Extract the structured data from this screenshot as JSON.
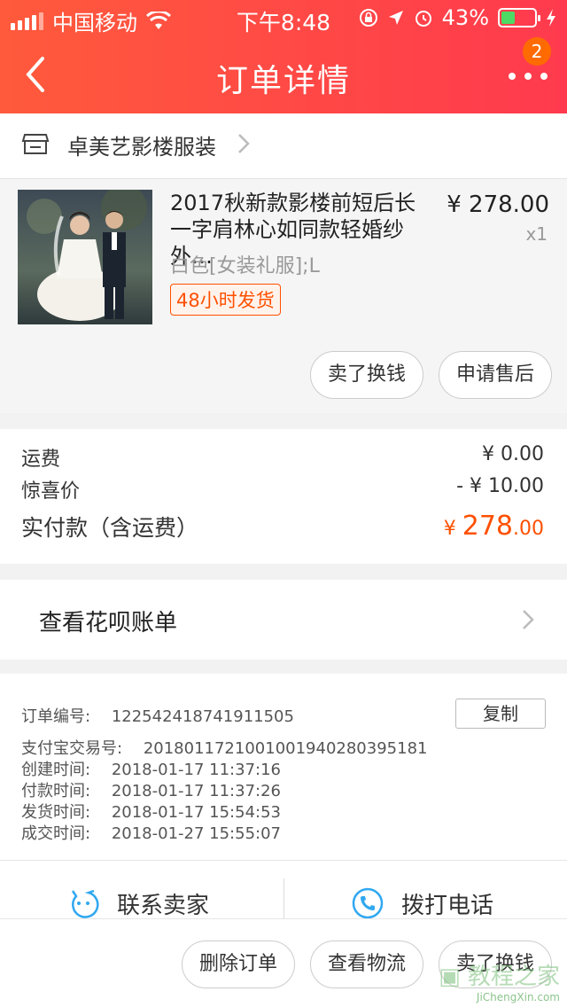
{
  "status_bar": {
    "carrier": "中国移动",
    "time": "下午8:48",
    "battery_percent": "43%",
    "battery_level": 0.43,
    "icons": [
      "signal-icon",
      "wifi-icon",
      "orientation-lock-icon",
      "location-arrow-icon",
      "alarm-icon",
      "battery-icon",
      "charging-icon"
    ]
  },
  "header": {
    "title": "订单详情",
    "notification_count": "2"
  },
  "shop": {
    "name": "卓美艺影楼服装"
  },
  "product": {
    "title": "2017秋新款影楼前短后长一字肩林心如同款轻婚纱外…",
    "price": "¥ 278.00",
    "quantity": "x1",
    "sku": "白色[女装礼服];L",
    "shipping_tag": "48小时发货",
    "buttons": {
      "sell": "卖了换钱",
      "after_sales": "申请售后"
    }
  },
  "costs": {
    "shipping_label": "运费",
    "shipping_value": "¥ 0.00",
    "discount_label": "惊喜价",
    "discount_value": "- ¥ 10.00",
    "paid_label": "实付款（含运费）",
    "paid_currency": "¥",
    "paid_int": "278",
    "paid_dec": ".00"
  },
  "huabei": {
    "label": "查看花呗账单"
  },
  "order_info": {
    "order_no_label": "订单编号:",
    "order_no": "122542418741911505",
    "copy_label": "复制",
    "alipay_label": "支付宝交易号:",
    "alipay_no": "2018011721001001940280395181",
    "created_label": "创建时间:",
    "created": "2018-01-17 11:37:16",
    "paid_label": "付款时间:",
    "paid": "2018-01-17 11:37:26",
    "shipped_label": "发货时间:",
    "shipped": "2018-01-17 15:54:53",
    "done_label": "成交时间:",
    "done": "2018-01-27 15:55:07"
  },
  "contact": {
    "seller": "联系卖家",
    "phone": "拨打电话"
  },
  "actions": {
    "delete": "删除订单",
    "logistics": "查看物流",
    "sell": "卖了换钱"
  },
  "watermark": {
    "site": "JiChengXin.com"
  },
  "colors": {
    "brand_red": "#ff4046",
    "price_orange": "#ff5000",
    "contact_blue": "#30a8f0"
  }
}
